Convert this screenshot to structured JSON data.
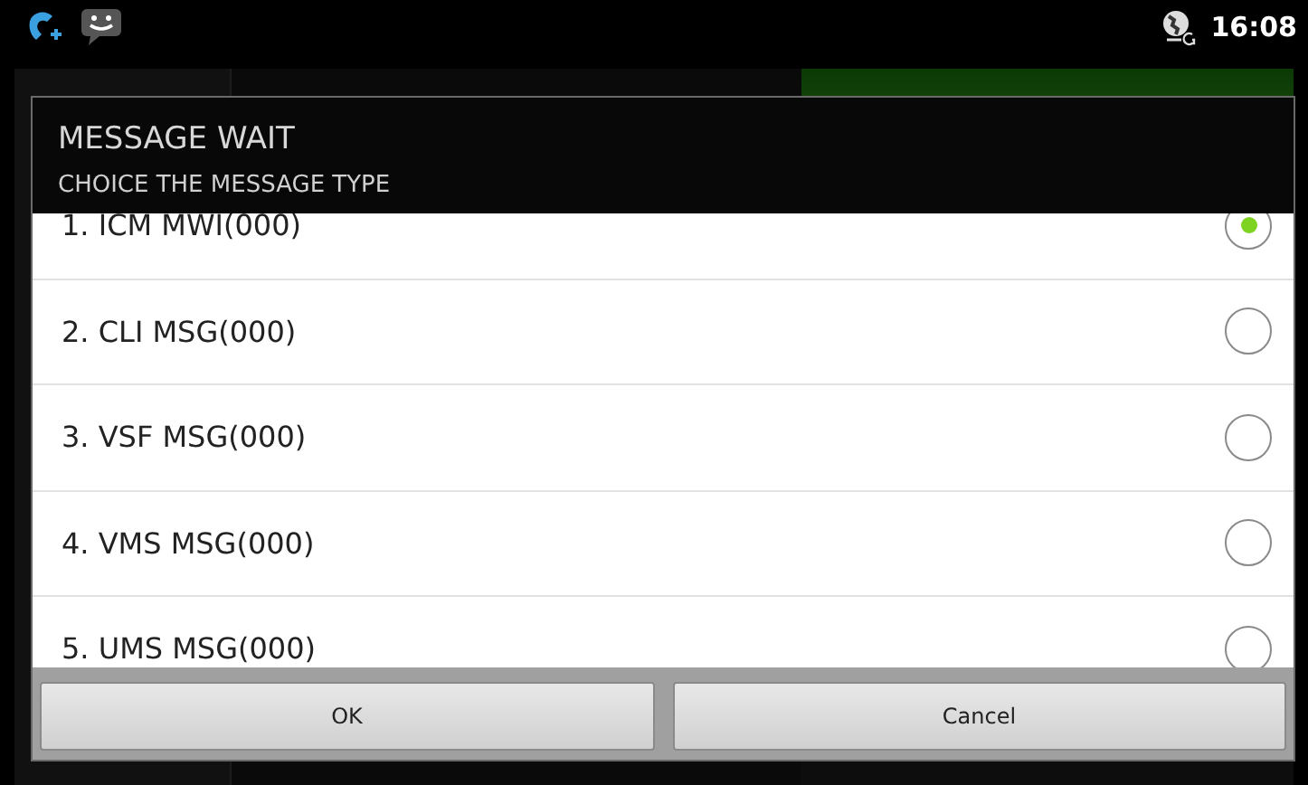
{
  "status_bar": {
    "time": "16:08"
  },
  "dialog": {
    "title": "MESSAGE WAIT",
    "subtitle": "CHOICE THE MESSAGE TYPE",
    "options": [
      {
        "label": "1. ICM MWI(000)",
        "selected": true
      },
      {
        "label": "2. CLI MSG(000)",
        "selected": false
      },
      {
        "label": "3. VSF MSG(000)",
        "selected": false
      },
      {
        "label": "4. VMS MSG(000)",
        "selected": false
      },
      {
        "label": "5. UMS MSG(000)",
        "selected": false
      }
    ],
    "buttons": [
      "OK",
      "Cancel"
    ]
  }
}
